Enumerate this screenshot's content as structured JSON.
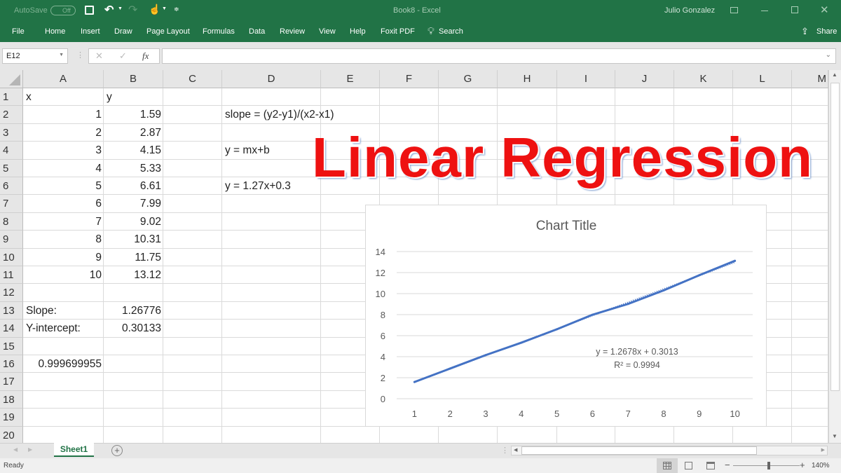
{
  "titlebar": {
    "autosave_label": "AutoSave",
    "autosave_state": "Off",
    "document_title": "Book8 - Excel",
    "user_name": "Julio Gonzalez",
    "icons": [
      "save-icon",
      "undo-icon",
      "redo-icon",
      "touch-mode-icon",
      "customize-qat-icon",
      "ribbon-display-icon",
      "minimize-icon",
      "maximize-icon",
      "close-icon"
    ]
  },
  "ribbon": {
    "tabs": [
      "File",
      "Home",
      "Insert",
      "Draw",
      "Page Layout",
      "Formulas",
      "Data",
      "Review",
      "View",
      "Help",
      "Foxit PDF"
    ],
    "search_label": "Search",
    "share_label": "Share"
  },
  "formula_bar": {
    "name_box": "E12",
    "formula": "",
    "fx_label": "fx"
  },
  "sheet": {
    "columns": [
      "A",
      "B",
      "C",
      "D",
      "E",
      "F",
      "G",
      "H",
      "I",
      "J",
      "K",
      "L",
      "M"
    ],
    "rows": [
      "1",
      "2",
      "3",
      "4",
      "5",
      "6",
      "7",
      "8",
      "9",
      "10",
      "11",
      "12",
      "13",
      "14",
      "15",
      "16",
      "17",
      "18",
      "19",
      "20"
    ],
    "cells": {
      "A1": "x",
      "B1": "y",
      "A2": "1",
      "B2": "1.59",
      "A3": "2",
      "B3": "2.87",
      "A4": "3",
      "B4": "4.15",
      "A5": "4",
      "B5": "5.33",
      "A6": "5",
      "B6": "6.61",
      "A7": "6",
      "B7": "7.99",
      "A8": "7",
      "B8": "9.02",
      "A9": "8",
      "B9": "10.31",
      "A10": "9",
      "B10": "11.75",
      "A11": "10",
      "B11": "13.12",
      "A13": "Slope:",
      "B13": "1.26776",
      "A14": "Y-intercept:",
      "B14": "0.30133",
      "A16": "0.999699955",
      "D2": "slope = (y2-y1)/(x2-x1)",
      "D4": "y = mx+b",
      "D6": "y = 1.27x+0.3"
    },
    "banner_text": "Linear Regression"
  },
  "chart_data": {
    "type": "line",
    "title": "Chart Title",
    "xlabel": "",
    "ylabel": "",
    "x": [
      1,
      2,
      3,
      4,
      5,
      6,
      7,
      8,
      9,
      10
    ],
    "series": [
      {
        "name": "y",
        "values": [
          1.59,
          2.87,
          4.15,
          5.33,
          6.61,
          7.99,
          9.02,
          10.31,
          11.75,
          13.12
        ],
        "color": "#4472c4"
      }
    ],
    "trendline": {
      "type": "linear",
      "equation": "y = 1.2678x + 0.3013",
      "r_squared": "R² = 0.9994",
      "slope": 1.2678,
      "intercept": 0.3013
    },
    "x_ticks": [
      "1",
      "2",
      "3",
      "4",
      "5",
      "6",
      "7",
      "8",
      "9",
      "10"
    ],
    "y_ticks": [
      "0",
      "2",
      "4",
      "6",
      "8",
      "10",
      "12",
      "14"
    ],
    "ylim": [
      0,
      14
    ],
    "grid": true,
    "legend": "none"
  },
  "sheet_tabs": {
    "active": "Sheet1",
    "add_label": "+"
  },
  "status_bar": {
    "status": "Ready",
    "zoom": "140%",
    "zoom_value_percent": 140
  }
}
